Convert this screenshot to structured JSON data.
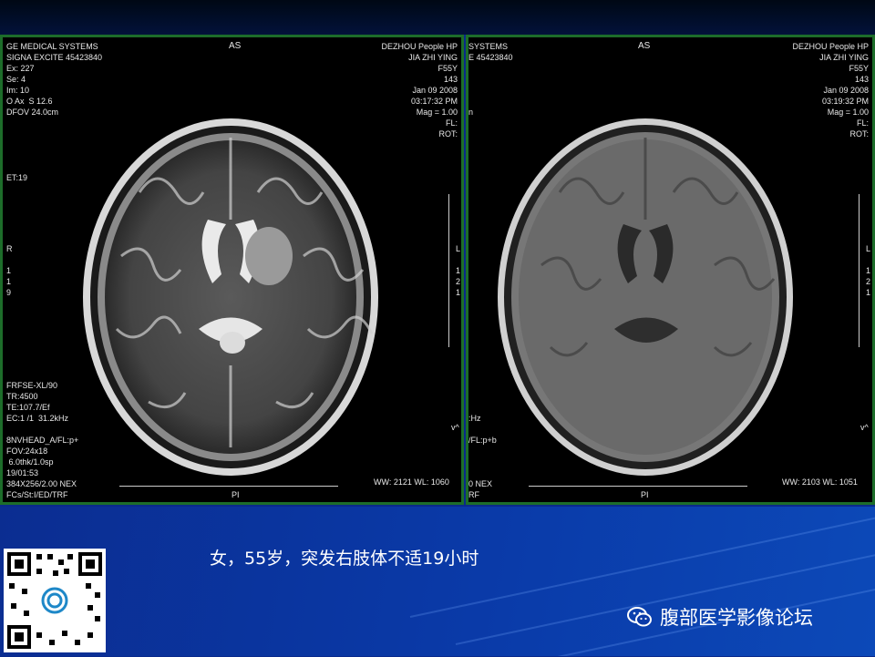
{
  "left_scan": {
    "manufacturer": "GE MEDICAL SYSTEMS",
    "scanner": "SIGNA EXCITE 45423840",
    "exam": "Ex: 227",
    "series": "Se: 4",
    "image": "Im: 10",
    "plane": "O Ax  S 12.6",
    "fov": "DFOV 24.0cm",
    "orientation_top": "AS",
    "hospital": "DEZHOU People HP",
    "patient": "JIA ZHI YING",
    "sex_age": "F55Y",
    "id": "143",
    "date": "Jan 09 2008",
    "time": "03:17:32 PM",
    "mag": "Mag = 1.00",
    "fl": "FL:",
    "rot": "ROT:",
    "et": "ET:19",
    "left_marker": "R",
    "left_marker_digits": "1\n1\n9",
    "right_marker": "L",
    "right_marker_digits": "1\n2\n1",
    "seq_params": "FRFSE-XL/90\nTR:4500\nTE:107.7/Ef\nEC:1 /1  31.2kHz",
    "coil_params": "8NVHEAD_A/FL:p+\nFOV:24x18\n 6.0thk/1.0sp\n19/01:53\n384X256/2.00 NEX\nFCs/St:I/ED/TRF",
    "va": "v^",
    "bottom_orient": "PI",
    "window": "WW: 2121 WL: 1060"
  },
  "right_scan": {
    "manufacturer": "SYSTEMS",
    "scanner": "E 45423840",
    "orientation_top": "AS",
    "hospital": "DEZHOU People HP",
    "patient": "JIA ZHI YING",
    "sex_age": "F55Y",
    "id": "143",
    "date": "Jan 09 2008",
    "time": "03:19:32 PM",
    "mag": "Mag = 1.00",
    "fl": "FL:",
    "rot": "ROT:",
    "cm": "n",
    "right_marker": "L",
    "right_marker_digits": "1\n2\n1",
    "khz": ":Hz",
    "coil_params": "/FL:p+b",
    "nex": "0 NEX",
    "trf": "RF",
    "va": "v^",
    "bottom_orient": "PI",
    "window": "WW: 2103 WL: 1051"
  },
  "caption": "女，55岁，突发右肢体不适19小时",
  "brand": "腹部医学影像论坛",
  "colors": {
    "frame": "#1d6d2a",
    "panel": "#0a3aa8"
  },
  "icons": {
    "wechat": "wechat-icon",
    "qr": "qr-code"
  }
}
